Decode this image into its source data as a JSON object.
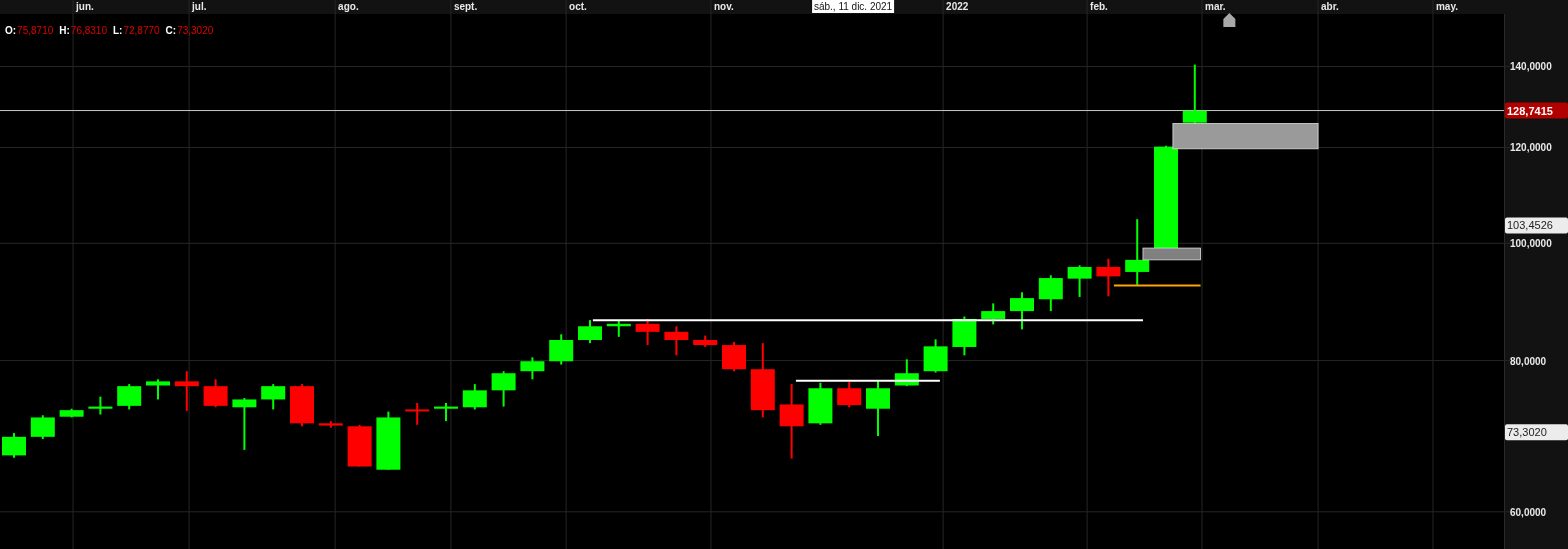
{
  "ohlc_legend": [
    {
      "label": "O:",
      "value": "75,8710"
    },
    {
      "label": "H:",
      "value": "76,8310"
    },
    {
      "label": "L:",
      "value": "72,8770"
    },
    {
      "label": "C:",
      "value": "73,3020"
    }
  ],
  "time_axis": {
    "labels": [
      "jun.",
      "jul.",
      "ago.",
      "sept.",
      "oct.",
      "nov.",
      "2022",
      "feb.",
      "mar.",
      "abr.",
      "may."
    ],
    "crosshair_label": "sáb., 11 dic. 2021"
  },
  "price_axis": {
    "labels": [
      "140,0000",
      "120,0000",
      "100,0000",
      "80,0000",
      "60,0000"
    ]
  },
  "price_tags": [
    {
      "kind": "last",
      "text": "128,7415"
    },
    {
      "kind": "crosshair",
      "text": "103,4526"
    },
    {
      "kind": "close",
      "text": "73,3020"
    }
  ]
}
